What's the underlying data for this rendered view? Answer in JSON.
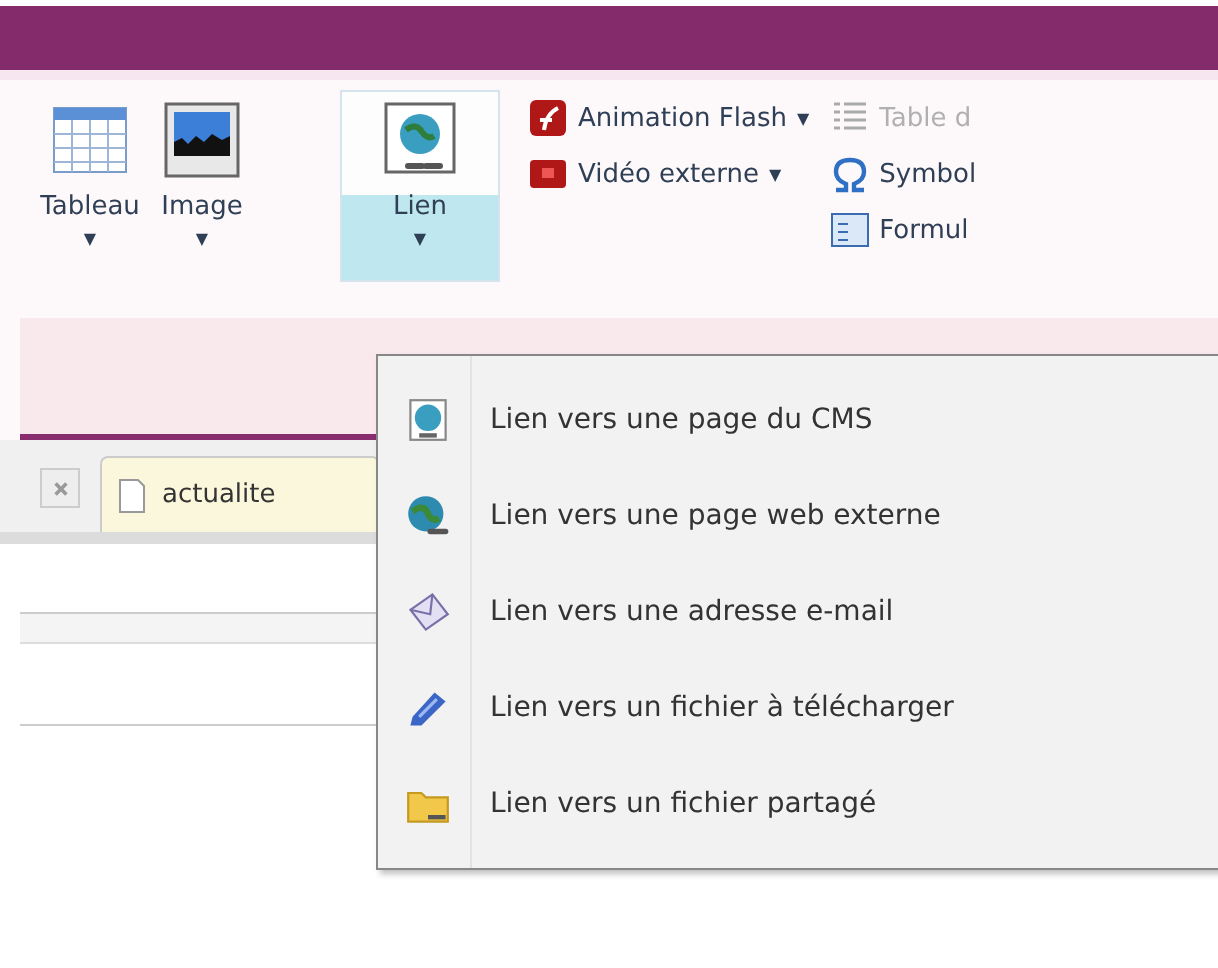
{
  "ribbon": {
    "large_buttons": [
      {
        "label": "Tableau",
        "kind": "table",
        "caret": "▼",
        "selected": false
      },
      {
        "label": "Image",
        "kind": "image",
        "caret": "▼",
        "selected": false
      },
      {
        "label": "Lien",
        "kind": "link",
        "caret": "▼",
        "selected": true
      }
    ],
    "small_columns": [
      [
        {
          "label": "Animation Flash",
          "kind": "flash",
          "caret": "▼",
          "disabled": false
        },
        {
          "label": "Vidéo externe",
          "kind": "video",
          "caret": "▼",
          "disabled": false
        }
      ],
      [
        {
          "label": "Table d",
          "kind": "toc",
          "disabled": true
        },
        {
          "label": "Symbol",
          "kind": "omega",
          "disabled": false
        },
        {
          "label": "Formul",
          "kind": "form",
          "disabled": false
        }
      ]
    ]
  },
  "tabs": [
    {
      "label": "actualite",
      "selected": true
    }
  ],
  "link_menu": [
    {
      "label": "Lien vers une page du CMS",
      "kind": "cms"
    },
    {
      "label": "Lien vers une page web externe",
      "kind": "globe"
    },
    {
      "label": "Lien vers une adresse e-mail",
      "kind": "mail"
    },
    {
      "label": "Lien vers un fichier à télécharger",
      "kind": "clip"
    },
    {
      "label": "Lien vers un fichier partagé",
      "kind": "folder"
    }
  ]
}
